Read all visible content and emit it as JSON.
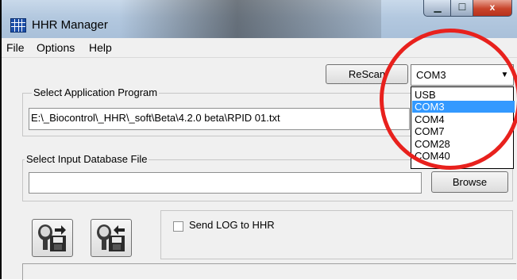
{
  "window": {
    "title": "HHR Manager",
    "controls": {
      "minimize": "▁",
      "maximize": "☐",
      "close": "x"
    }
  },
  "menu": [
    "File",
    "Options",
    "Help"
  ],
  "rescan_label": "ReScan",
  "port": {
    "selected": "COM3",
    "options": [
      "USB",
      "COM3",
      "COM4",
      "COM7",
      "COM28",
      "COM40"
    ],
    "highlighted": "COM3"
  },
  "app_program": {
    "label": "Select Application Program",
    "value": "E:\\_Biocontrol\\_HHR\\_soft\\Beta\\4.2.0 beta\\RPID 01.txt"
  },
  "input_db": {
    "label": "Select Input Database File",
    "value": "",
    "browse_label": "Browse"
  },
  "send_log_label": "Send LOG to HHR",
  "colors": {
    "annotation": "#e8211d",
    "selection": "#3399ff"
  },
  "icons": {
    "upload": "device-to-disk-icon",
    "download": "disk-to-device-icon"
  }
}
